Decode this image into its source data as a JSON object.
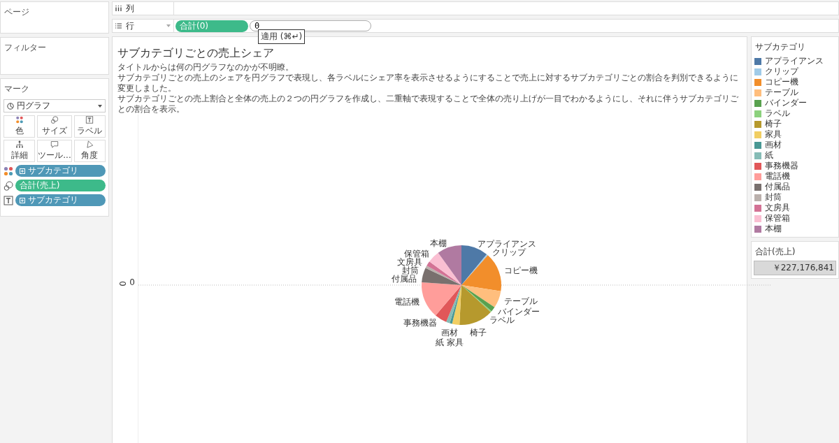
{
  "pages_panel": {
    "title": "ページ"
  },
  "filters_panel": {
    "title": "フィルター"
  },
  "marks_panel": {
    "title": "マーク",
    "mark_type": "円グラフ",
    "cards": [
      {
        "kind": "color",
        "label": "色",
        "pill": {
          "kind": "dimension",
          "label": "サブカテゴリ"
        }
      },
      {
        "kind": "size",
        "label": "サイズ",
        "pill": {
          "kind": "measure",
          "label": "合計(売上)"
        }
      },
      {
        "kind": "label",
        "label": "ラベル",
        "pill": {
          "kind": "dimension",
          "label": "サブカテゴリ"
        }
      },
      {
        "kind": "detail",
        "label": "詳細"
      },
      {
        "kind": "tooltip",
        "label": "ツール..."
      },
      {
        "kind": "angle",
        "label": "角度"
      }
    ]
  },
  "columns_shelf": {
    "label": "列"
  },
  "rows_shelf": {
    "label": "行",
    "pills": [
      {
        "kind": "measure",
        "label": "合計(0)"
      }
    ],
    "editor": {
      "value": "0"
    },
    "tooltip": "適用 (⌘↵)"
  },
  "sheet": {
    "title": "サブカテゴリごとの売上シェア",
    "description": [
      "タイトルからは何の円グラフなのかが不明瞭。",
      "サブカテゴリごとの売上のシェアを円グラフで表現し、各ラベルにシェア率を表示させるようにすることで売上に対するサブカテゴリごとの割合を判別できるように変更しました。",
      "サブカテゴリごとの売上割合と全体の売上の２つの円グラフを作成し、二重軸で表現することで全体の売り上げが一目でわかるようにし、それに伴うサブカテゴリごとの割合を表示。"
    ],
    "axis": {
      "title": "0",
      "tick": "0"
    },
    "chart_data": {
      "type": "pie",
      "categories": [
        "アプライアンス",
        "クリップ",
        "コピー機",
        "テーブル",
        "バインダー",
        "ラベル",
        "椅子",
        "家具",
        "画材",
        "紙",
        "事務機器",
        "電話機",
        "付属品",
        "封筒",
        "文房具",
        "保管箱",
        "本棚"
      ],
      "series": [
        {
          "values": [
            11,
            0.6,
            16,
            7,
            2,
            0.5,
            14,
            3,
            1,
            1.5,
            5,
            15,
            6,
            1,
            2,
            5,
            10
          ]
        }
      ],
      "colors": [
        "#4e79a7",
        "#a0cbe8",
        "#f28e2b",
        "#ffbe7d",
        "#59a14f",
        "#8cd17d",
        "#b6992d",
        "#f1ce63",
        "#499894",
        "#86bcb6",
        "#e15759",
        "#ff9d9a",
        "#79706e",
        "#bab0ac",
        "#d37295",
        "#fabfd2",
        "#b07aa1"
      ]
    }
  },
  "color_legend": {
    "title": "サブカテゴリ",
    "items": [
      {
        "label": "アプライアンス",
        "color": "#4e79a7"
      },
      {
        "label": "クリップ",
        "color": "#a0cbe8"
      },
      {
        "label": "コピー機",
        "color": "#f28e2b"
      },
      {
        "label": "テーブル",
        "color": "#ffbe7d"
      },
      {
        "label": "バインダー",
        "color": "#59a14f"
      },
      {
        "label": "ラベル",
        "color": "#8cd17d"
      },
      {
        "label": "椅子",
        "color": "#b6992d"
      },
      {
        "label": "家具",
        "color": "#f1ce63"
      },
      {
        "label": "画材",
        "color": "#499894"
      },
      {
        "label": "紙",
        "color": "#86bcb6"
      },
      {
        "label": "事務機器",
        "color": "#e15759"
      },
      {
        "label": "電話機",
        "color": "#ff9d9a"
      },
      {
        "label": "付属品",
        "color": "#79706e"
      },
      {
        "label": "封筒",
        "color": "#bab0ac"
      },
      {
        "label": "文房具",
        "color": "#d37295"
      },
      {
        "label": "保管箱",
        "color": "#fabfd2"
      },
      {
        "label": "本棚",
        "color": "#b07aa1"
      }
    ]
  },
  "size_legend": {
    "title": "合計(売上)",
    "value": "￥227,176,841"
  }
}
